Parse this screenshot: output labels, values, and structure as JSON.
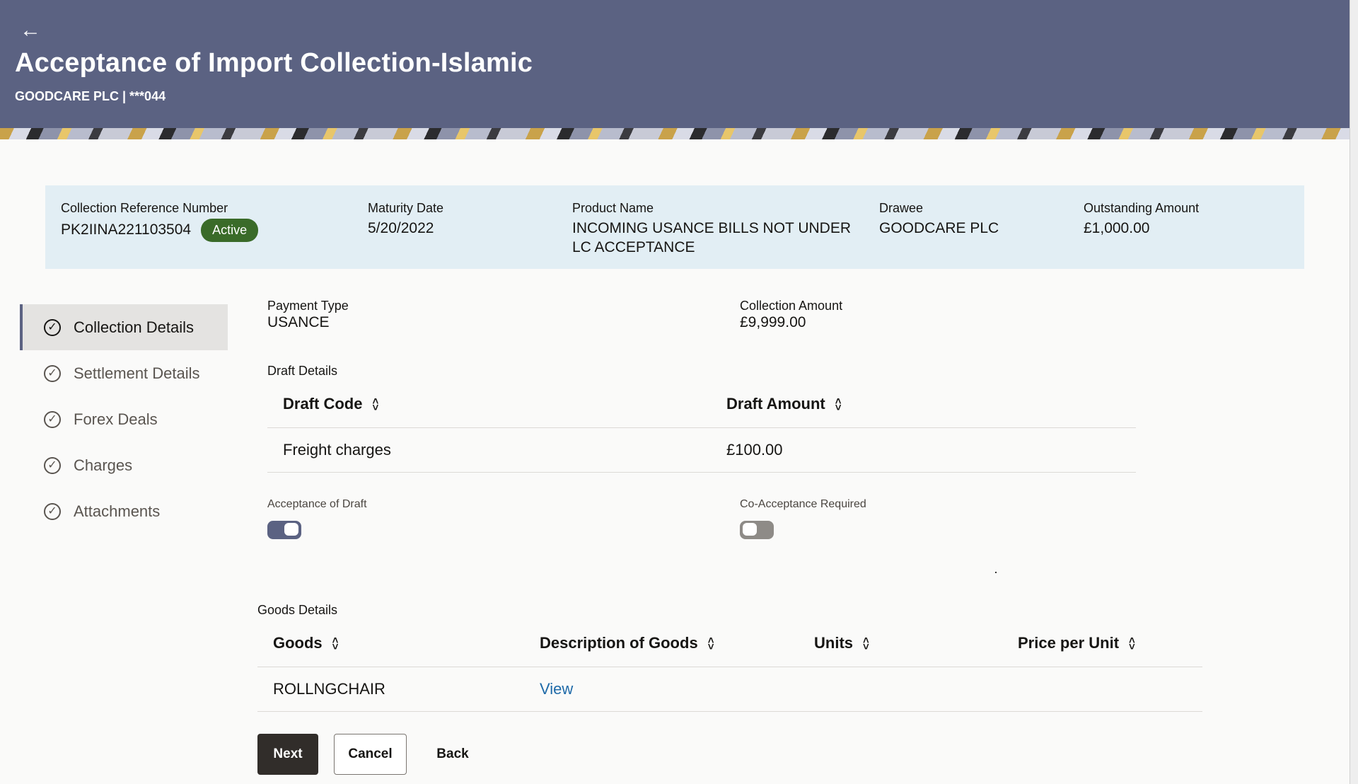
{
  "header": {
    "title": "Acceptance of Import Collection-Islamic",
    "subtitle": "GOODCARE PLC | ***044",
    "back_icon": "←"
  },
  "summary": {
    "ref_label": "Collection Reference Number",
    "ref_value": "PK2IINA221103504",
    "status": "Active",
    "maturity_label": "Maturity Date",
    "maturity_value": "5/20/2022",
    "product_label": "Product Name",
    "product_value": "INCOMING USANCE BILLS NOT UNDER LC ACCEPTANCE",
    "drawee_label": "Drawee",
    "drawee_value": "GOODCARE PLC",
    "outstanding_label": "Outstanding Amount",
    "outstanding_value": "£1,000.00"
  },
  "nav": {
    "items": [
      {
        "label": "Collection Details",
        "icon": "check-circle-icon"
      },
      {
        "label": "Settlement Details",
        "icon": "check-circle-icon"
      },
      {
        "label": "Forex Deals",
        "icon": "check-circle-icon"
      },
      {
        "label": "Charges",
        "icon": "check-circle-icon"
      },
      {
        "label": "Attachments",
        "icon": "check-circle-icon"
      }
    ],
    "check_glyph": "✓",
    "active_index": 0
  },
  "details": {
    "payment_type_label": "Payment Type",
    "payment_type_value": "USANCE",
    "collection_amount_label": "Collection Amount",
    "collection_amount_value": "£9,999.00",
    "draft_section": "Draft Details",
    "draft_columns": [
      "Draft Code",
      "Draft Amount"
    ],
    "draft_rows": [
      {
        "code": "Freight charges",
        "amount": "£100.00"
      }
    ],
    "acceptance_label": "Acceptance of Draft",
    "acceptance_on": true,
    "co_acceptance_label": "Co-Acceptance Required",
    "co_acceptance_on": false,
    "goods_section": "Goods Details",
    "goods_columns": [
      "Goods",
      "Description of Goods",
      "Units",
      "Price per Unit"
    ],
    "goods_rows": [
      {
        "goods": "ROLLNGCHAIR",
        "description": "View",
        "units": "",
        "price": ""
      }
    ]
  },
  "buttons": {
    "next": "Next",
    "cancel": "Cancel",
    "back": "Back"
  },
  "sort_glyph_up": "˄",
  "sort_glyph_down": "˅",
  "colors": {
    "header_bg": "#5b6282",
    "summary_bg": "#e2eef4",
    "badge_bg": "#3a6b29",
    "primary_button": "#312d2a",
    "link": "#1e6aa8"
  }
}
